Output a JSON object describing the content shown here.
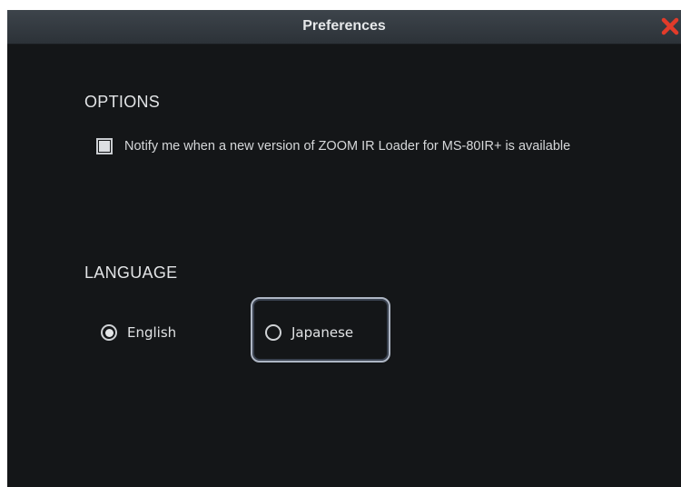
{
  "window": {
    "title": "Preferences",
    "close_icon": "close-icon",
    "close_color": "#e23b2a"
  },
  "options": {
    "heading": "OPTIONS",
    "notify_checkbox": {
      "label": "Notify me when a new version of ZOOM IR Loader for MS-80IR+ is available",
      "checked": true
    }
  },
  "language": {
    "heading": "LANGUAGE",
    "options": [
      {
        "label": "English",
        "selected": true
      },
      {
        "label": "Japanese",
        "selected": false,
        "focused": true
      }
    ]
  }
}
